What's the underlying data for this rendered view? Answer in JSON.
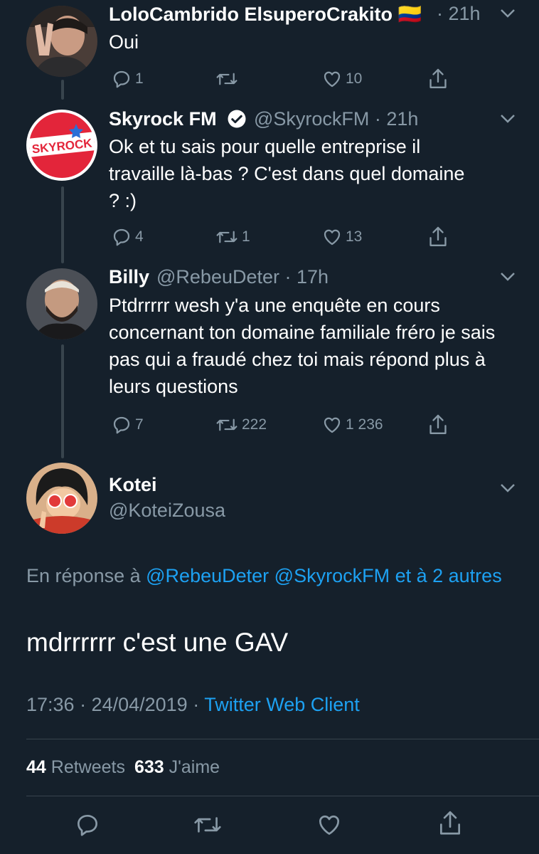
{
  "tweets": [
    {
      "name": "LoloCambrido ElsuperoCrakito",
      "flag": "🇨🇴",
      "time": "· 21h",
      "text": "Oui",
      "reply_count": "1",
      "retweet_count": "",
      "like_count": "10"
    },
    {
      "name": "Skyrock FM",
      "handle": "@SkyrockFM · 21h",
      "text": "Ok et tu sais pour quelle entreprise il travaille là-bas ? C'est dans quel domaine ? :)",
      "reply_count": "4",
      "retweet_count": "1",
      "like_count": "13",
      "avatar_text": "SKYROCK"
    },
    {
      "name": "Billy",
      "handle": "@RebeuDeter · 17h",
      "text": "Ptdrrrrr wesh y'a une enquête en cours concernant ton domaine familiale fréro je sais pas qui a fraudé chez toi mais répond plus à leurs questions",
      "reply_count": "7",
      "retweet_count": "222",
      "like_count": "1 236"
    }
  ],
  "main": {
    "name": "Kotei",
    "handle": "@KoteiZousa",
    "reply_prefix": "En réponse à",
    "reply_to_1": "@RebeuDeter",
    "reply_to_2": "@SkyrockFM",
    "reply_to_others": "et à 2 autres",
    "text": "mdrrrrrr c'est une GAV",
    "timestamp": "17:36 · 24/04/2019 ·",
    "client": "Twitter Web Client",
    "retweets_count": "44",
    "retweets_label": "Retweets",
    "likes_count": "633",
    "likes_label": "J'aime"
  },
  "colors": {
    "background": "#15202b",
    "muted": "#8899a6",
    "link": "#1da1f2",
    "divider": "#38444d"
  },
  "icons": [
    "reply-icon",
    "retweet-icon",
    "like-icon",
    "share-icon",
    "chevron-down-icon",
    "verified-badge-icon"
  ]
}
